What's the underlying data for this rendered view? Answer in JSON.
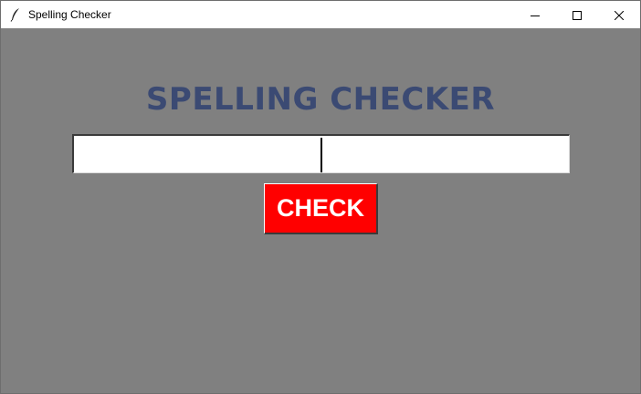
{
  "window": {
    "title": "Spelling Checker",
    "icon": "feather-icon",
    "controls": [
      "minimize-icon",
      "maximize-icon",
      "close-icon"
    ]
  },
  "main": {
    "heading": "SPELLING CHECKER",
    "input": {
      "value": "",
      "placeholder": ""
    },
    "check_button_label": "CHECK"
  },
  "colors": {
    "background": "#808080",
    "heading": "#3b4a73",
    "button": "#ff0000",
    "button_text": "#ffffff"
  }
}
